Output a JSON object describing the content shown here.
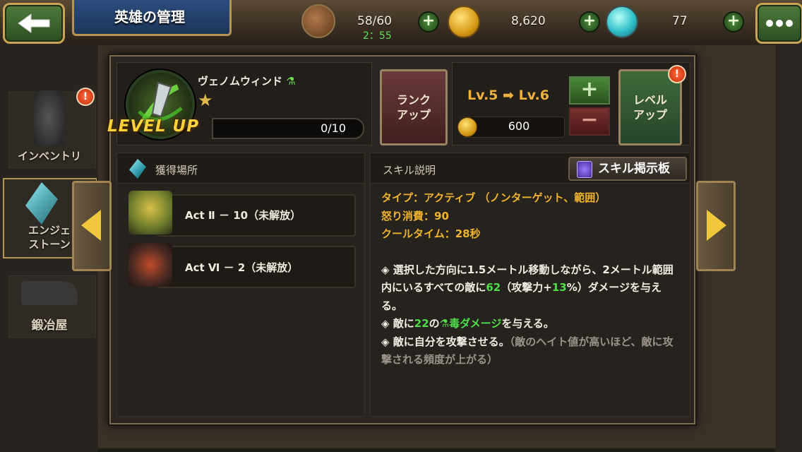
{
  "header": {
    "title": "英雄の管理",
    "stamina": "58/60",
    "stamina_timer": "2：55",
    "gold": "8,620",
    "gems": "77"
  },
  "left_menu": {
    "inventory": "インベントリ",
    "engine_stone": "エンジェ\nストーン",
    "blacksmith": "鍛冶屋"
  },
  "hero": {
    "name": "ヴェノムウィンド",
    "element_icon": "poison-flask-icon",
    "stars": "★",
    "level_up_banner": "LEVEL UP",
    "xp": "0/10",
    "xp_fraction": 0,
    "rank_up_label": "ランク\nアップ",
    "level_from": "Lv.5",
    "level_to": "Lv.6",
    "level_cost": "600",
    "level_up_label": "レベル\nアップ"
  },
  "acquisition": {
    "title": "獲得場所",
    "items": [
      {
        "label": "Act Ⅱ － 10（未解放）"
      },
      {
        "label": "Act Ⅵ － 2（未解放）"
      }
    ]
  },
  "skill": {
    "title": "スキル説明",
    "board_button": "スキル掲示板",
    "type_line": "タイプ：アクティブ （ノンターゲット、範囲）",
    "rage_line": "怒り消費：90",
    "cooldown_line": "クールタイム：28秒",
    "desc1_a": "◈ 選択した方向に1.5メートル移動しながら、2メートル範囲内にいるすべての敵に",
    "desc1_num1": "62",
    "desc1_b": "（攻撃力+",
    "desc1_num2": "13",
    "desc1_c": "%）ダメージを与える。",
    "desc2_a": "◈ 敵に",
    "desc2_num": "22",
    "desc2_b": "の",
    "desc2_poison": "毒ダメージ",
    "desc2_c": "を与える。",
    "desc3_a": "◈ 敵に自分を攻撃させる。",
    "desc3_gray": "（敵のヘイト値が高いほど、敵に攻撃される頻度が上がる）"
  },
  "badges": {
    "alert": "!"
  },
  "colors": {
    "gold_text": "#f0b42c",
    "green_text": "#4ee04a",
    "gray_text": "#9a948a"
  }
}
